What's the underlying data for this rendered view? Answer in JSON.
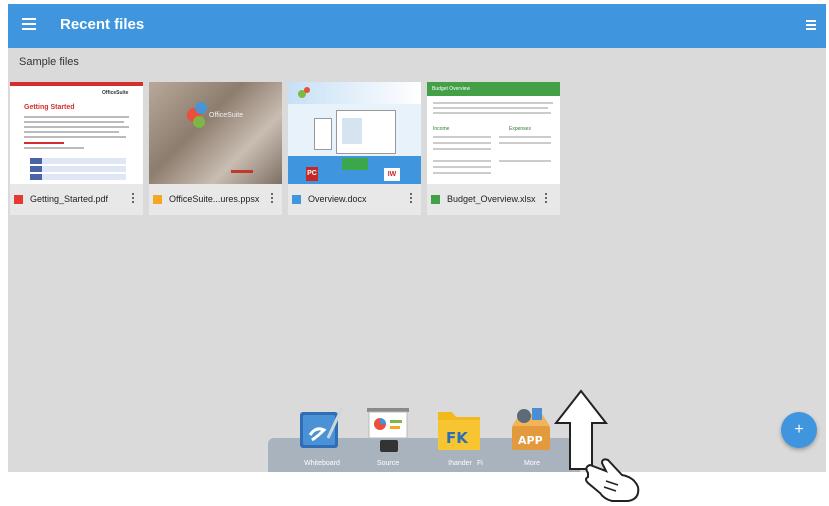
{
  "app": {
    "title": "Recent files"
  },
  "section": {
    "title": "Sample files"
  },
  "files": [
    {
      "name": "Getting_Started.pdf",
      "type": "pdf",
      "color": "#e53935"
    },
    {
      "name": "OfficeSuite...ures.ppsx",
      "type": "ppsx",
      "color": "#f5a623"
    },
    {
      "name": "Overview.docx",
      "type": "docx",
      "color": "#3f96df"
    },
    {
      "name": "Budget_Overview.xlsx",
      "type": "xlsx",
      "color": "#43a047"
    }
  ],
  "thumbs": {
    "pdf": {
      "logo": "OfficeSuite",
      "heading": "Getting Started"
    },
    "ppsx": {
      "logo": "OfficeSuite"
    },
    "docx": {
      "badge_left": "PC",
      "badge_right": "IW"
    },
    "xlsx": {
      "header": "Budget Overview",
      "col1": "Income",
      "col2": "Expenses"
    }
  },
  "dock": [
    {
      "label": "Whiteboard",
      "icon": "whiteboard-icon"
    },
    {
      "label": "Source",
      "icon": "source-icon"
    },
    {
      "label": "Ihander",
      "icon": "file-manager-icon"
    },
    {
      "label": "More",
      "icon": "app-store-icon"
    }
  ],
  "dock_extra_label": "Fi",
  "fab": {
    "label": "+"
  },
  "colors": {
    "accent": "#3f96df",
    "background": "#dadada"
  }
}
